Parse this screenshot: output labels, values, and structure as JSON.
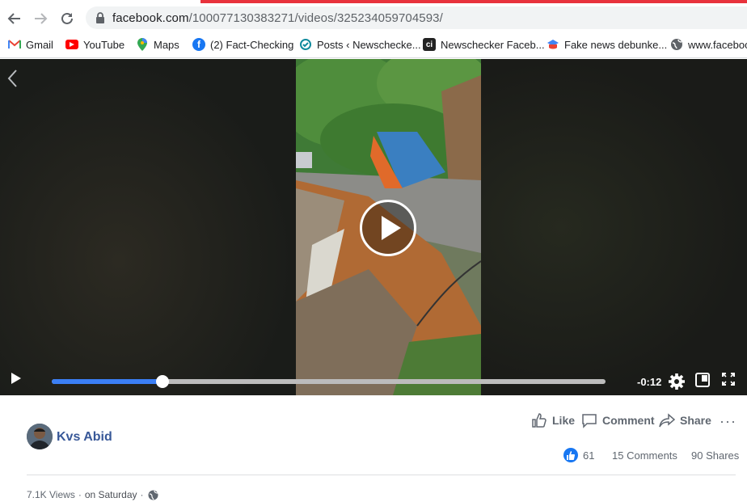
{
  "browser": {
    "url_host": "facebook.com",
    "url_path": "/100077130383271/videos/325234059704593/",
    "accent_color": "#e8323c"
  },
  "bookmarks": [
    {
      "label": "Gmail",
      "icon": "gmail-icon"
    },
    {
      "label": "YouTube",
      "icon": "youtube-icon"
    },
    {
      "label": "Maps",
      "icon": "maps-icon"
    },
    {
      "label": "(2) Fact-Checking",
      "icon": "facebook-icon"
    },
    {
      "label": "Posts ‹ Newschecke...",
      "icon": "newschecker-icon"
    },
    {
      "label": "Newschecker Faceb...",
      "icon": "newschecker-c-icon"
    },
    {
      "label": "Fake news debunke...",
      "icon": "cap-icon"
    },
    {
      "label": "www.faceboo",
      "icon": "globe-icon"
    }
  ],
  "player": {
    "time_remaining": "-0:12",
    "progress": 0.2
  },
  "post": {
    "author": "Kvs Abid",
    "actions": {
      "like": "Like",
      "comment": "Comment",
      "share": "Share",
      "more": "···"
    },
    "reactions_count": "61",
    "comments": "15 Comments",
    "shares": "90 Shares",
    "views": "7.1K Views",
    "separator": "·",
    "posted": "on Saturday"
  }
}
